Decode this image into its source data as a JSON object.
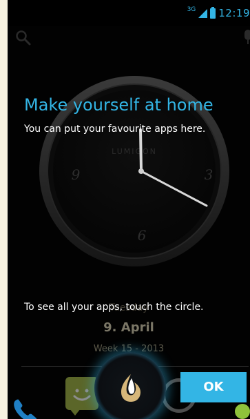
{
  "status_bar": {
    "network": "3G",
    "time": "12:19",
    "accent_color": "#33b5e5"
  },
  "top_bar": {
    "search_icon": "search-icon",
    "mic_icon": "mic-icon"
  },
  "clock_widget": {
    "brand": "LUMIGON",
    "numerals": [
      "9",
      "3",
      "6"
    ]
  },
  "overlay": {
    "title": "Make yourself at home",
    "subtitle": "You can put your favourite apps here.",
    "bottom_hint": "To see all your apps, touch the circle.",
    "ok_label": "OK"
  },
  "date_widget": {
    "weekday": "Tuesday",
    "date": "9. April",
    "week": "Week 15 - 2013"
  },
  "dock": {
    "items": [
      "phone-icon",
      "messaging-icon",
      "apps-circle",
      "camera-icon"
    ]
  }
}
